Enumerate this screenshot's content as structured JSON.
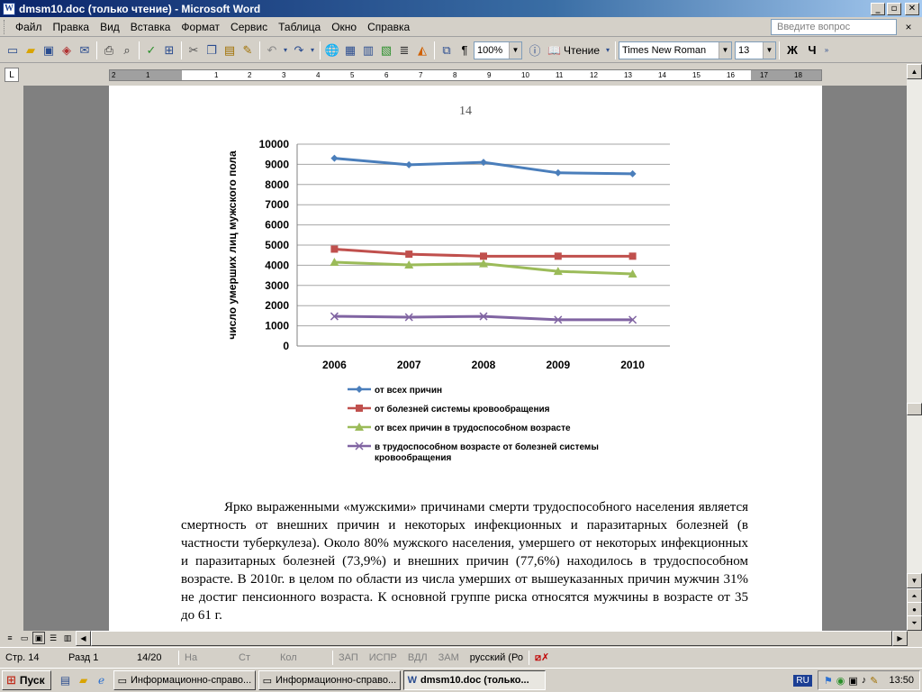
{
  "window": {
    "title": "dmsm10.doc (только чтение) - Microsoft Word",
    "app_icon": "W"
  },
  "menu": {
    "items": [
      "Файл",
      "Правка",
      "Вид",
      "Вставка",
      "Формат",
      "Сервис",
      "Таблица",
      "Окно",
      "Справка"
    ],
    "help_placeholder": "Введите вопрос",
    "close_label": "×"
  },
  "toolbar": {
    "zoom": "100%",
    "reading_label": "Чтение",
    "font_name": "Times New Roman",
    "font_size": "13",
    "bold_label": "Ж",
    "italic_label": "Ч"
  },
  "ruler": {
    "corner": "L",
    "numbers": [
      "2",
      "1",
      "1",
      "2",
      "3",
      "4",
      "5",
      "6",
      "7",
      "8",
      "9",
      "10",
      "11",
      "12",
      "13",
      "14",
      "15",
      "16",
      "17",
      "18"
    ]
  },
  "page": {
    "number": "14",
    "body_text": "Ярко выраженными «мужскими» причинами смерти трудоспособного населения является смертность от внешних причин и некоторых инфекционных и паразитарных болезней (в частности туберкулеза). Около 80% мужского населения, умершего от некоторых инфекционных и паразитарных болезней (73,9%) и внешних причин (77,6%) находилось в трудоспособном возрасте. В 2010г. в целом по области из числа умерших от вышеуказанных причин мужчин 31% не достиг пенсионного возраста. К основной группе риска относятся мужчины в возрасте от 35 до 61 г."
  },
  "chart_data": {
    "type": "line",
    "ylabel": "число умерших лиц мужского пола",
    "xlabel": "",
    "categories": [
      "2006",
      "2007",
      "2008",
      "2009",
      "2010"
    ],
    "ylim": [
      0,
      10000
    ],
    "yticks": [
      "0",
      "1000",
      "2000",
      "3000",
      "4000",
      "5000",
      "6000",
      "7000",
      "8000",
      "9000",
      "10000"
    ],
    "grid": true,
    "legend_position": "bottom",
    "series": [
      {
        "name": "от всех причин",
        "values": [
          9300,
          8980,
          9100,
          8580,
          8530
        ],
        "color": "#4a7ebb",
        "marker": "diamond"
      },
      {
        "name": "от болезней системы кровообращения",
        "values": [
          4800,
          4550,
          4450,
          4450,
          4450
        ],
        "color": "#c0504d",
        "marker": "square"
      },
      {
        "name": "от всех причин в трудоспособном возрасте",
        "values": [
          4150,
          4020,
          4080,
          3700,
          3570
        ],
        "color": "#9bbb59",
        "marker": "triangle"
      },
      {
        "name": "в трудоспособном возрасте от болезней системы кровообращения",
        "values": [
          1470,
          1430,
          1470,
          1300,
          1300
        ],
        "color": "#8064a2",
        "marker": "x"
      }
    ]
  },
  "legend_lines": {
    "l4a": "в трудоспособном возрасте от болезней системы",
    "l4b": "кровообращения"
  },
  "status": {
    "page": "Стр. 14",
    "section": "Разд 1",
    "pages": "14/20",
    "at": "На",
    "line": "Ст",
    "col": "Кол",
    "rec": "ЗАП",
    "trk": "ИСПР",
    "ext": "ВДЛ",
    "ovr": "ЗАМ",
    "language": "русский (Ро"
  },
  "taskbar": {
    "start_label": "Пуск",
    "tasks": [
      "Информационно-справо...",
      "Информационно-справо...",
      "dmsm10.doc (только..."
    ],
    "lang": "RU",
    "clock": "13:50"
  }
}
